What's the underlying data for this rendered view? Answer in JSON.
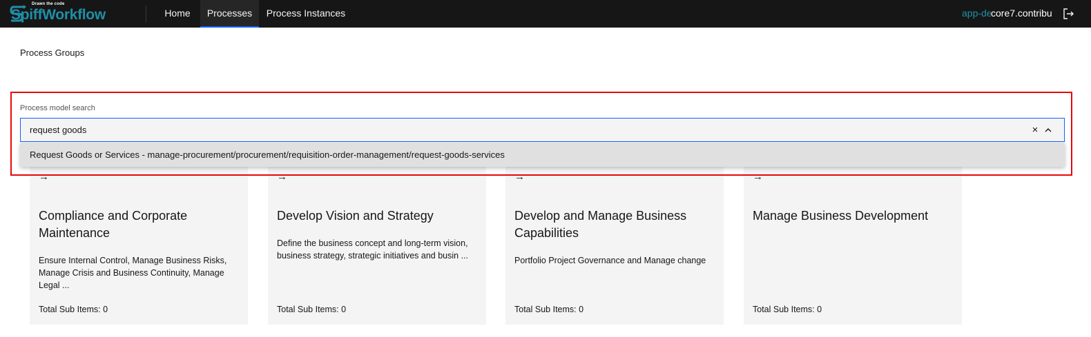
{
  "header": {
    "logo_tagline": "Drawn the code",
    "logo_text": "SpiffWorkflow",
    "nav": [
      {
        "label": "Home"
      },
      {
        "label": "Processes"
      },
      {
        "label": "Process Instances"
      }
    ],
    "environment": "app-de",
    "user": "core7.contribu",
    "logout_icon": "logout-icon"
  },
  "breadcrumb": "Process Groups",
  "search": {
    "label": "Process model search",
    "value": "request goods",
    "clear_icon": "×",
    "result": "Request Goods or Services - manage-procurement/procurement/requisition-order-management/request-goods-services"
  },
  "cards": [
    {
      "arrow": "→",
      "title": "Compliance and Corporate Maintenance",
      "description": "Ensure Internal Control, Manage Business Risks, Manage Crisis and Business Continuity, Manage Legal ...",
      "total": "Total Sub Items: 0"
    },
    {
      "arrow": "→",
      "title": "Develop Vision and Strategy",
      "description": "Define the business concept and long-term vision, business strategy, strategic initiatives and busin ...",
      "total": "Total Sub Items: 0"
    },
    {
      "arrow": "→",
      "title": "Develop and Manage Business Capabilities",
      "description": "Portfolio Project Governance and Manage change",
      "total": "Total Sub Items: 0"
    },
    {
      "arrow": "→",
      "title": "Manage Business Development",
      "description": "",
      "total": "Total Sub Items: 0"
    }
  ],
  "colors": {
    "header_bg": "#161616",
    "brand": "#1f8fa8",
    "accent": "#0f62fe",
    "highlight": "#e4080a",
    "card_bg": "#f4f4f4"
  }
}
